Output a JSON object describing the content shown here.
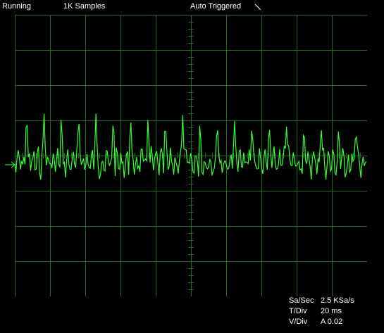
{
  "status": {
    "run_state": "Running",
    "samples": "1K Samples",
    "trigger": "Auto Triggered",
    "trigger_edge_icon": "falling-edge-icon"
  },
  "readouts": {
    "sample_rate_label": "Sa/Sec",
    "sample_rate_value": "2.5 KSa/s",
    "time_div_label": "T/Div",
    "time_div_value": "20 ms",
    "volt_div_label": "V/Div",
    "volt_div_value": "A 0.02"
  },
  "colors": {
    "background": "#000000",
    "grid": "#1f6a1f",
    "trace": "#33ff33",
    "text": "#ffffff"
  },
  "waveform": {
    "channel": "A",
    "ground_marker_icon": "arrow-right-icon"
  }
}
